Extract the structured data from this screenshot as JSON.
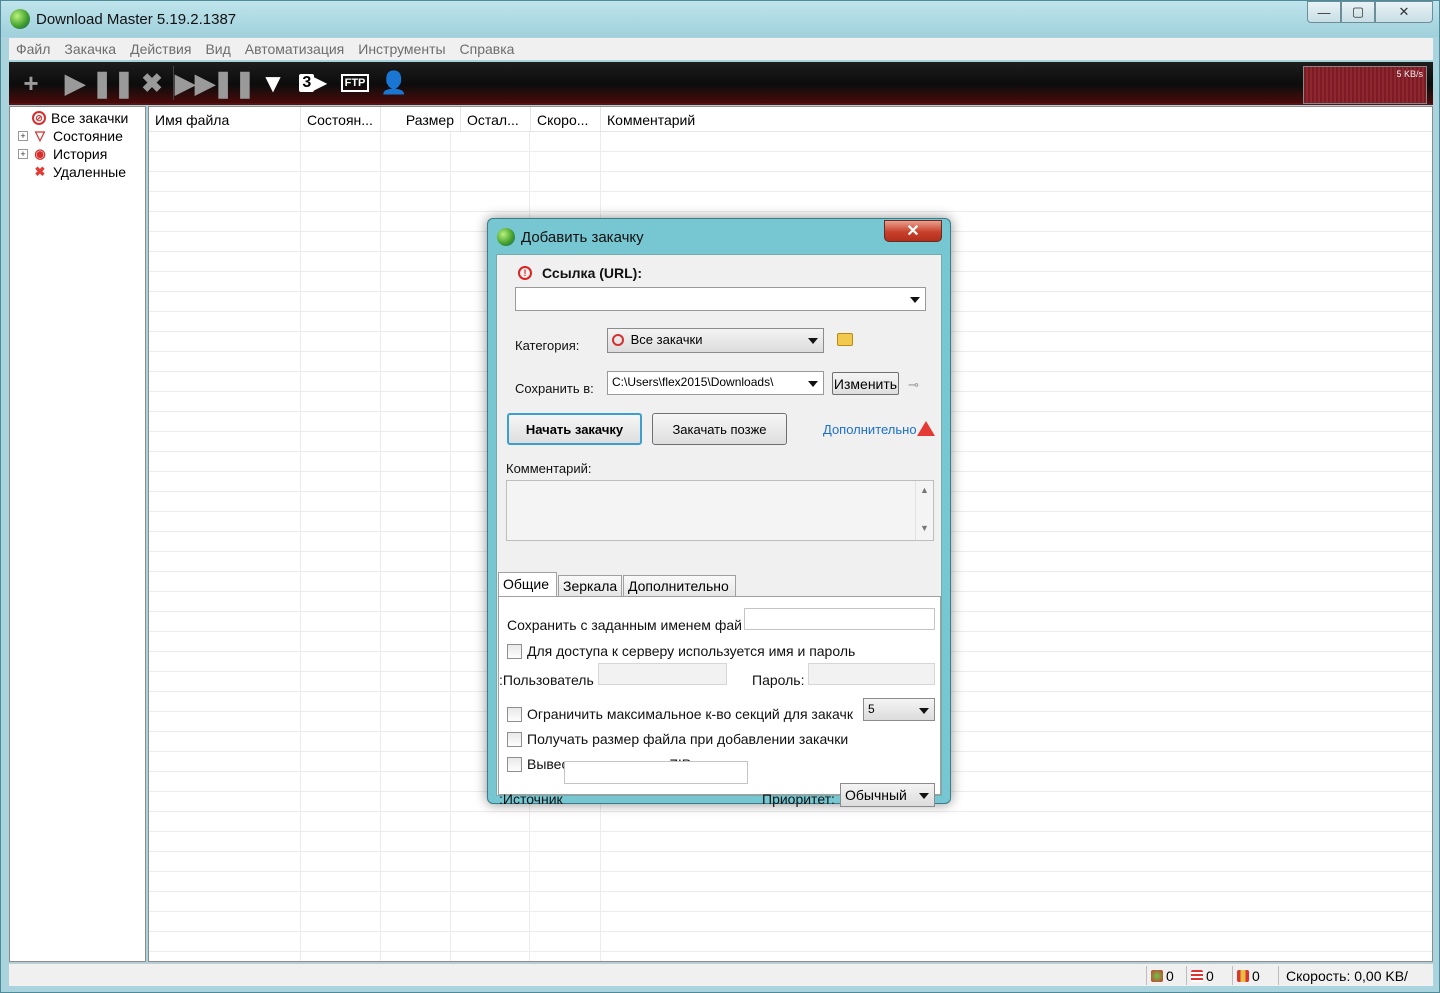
{
  "window": {
    "title": "Download Master 5.19.2.1387",
    "caption_min": "—",
    "caption_max": "▢",
    "caption_close": "✕"
  },
  "menu": [
    "Файл",
    "Закачка",
    "Действия",
    "Вид",
    "Автоматизация",
    "Инструменты",
    "Справка"
  ],
  "toolbar": {
    "buttons": [
      "add-icon",
      "play-icon",
      "pause-icon",
      "stop-icon",
      "play-all-icon",
      "pause-all-icon",
      "scheduler-icon",
      "turbo-icon",
      "ftp-icon",
      "user-icon"
    ],
    "ftp_label": "FTP",
    "turbo_label": "3",
    "speed_graph_label": "5 KB/s"
  },
  "tree": {
    "items": [
      {
        "label": "Все закачки",
        "icon": "all-downloads-icon",
        "color": "#d62f2f"
      },
      {
        "label": "Состояние",
        "icon": "status-filter-icon",
        "color": "#d62f2f"
      },
      {
        "label": "История",
        "icon": "history-icon",
        "color": "#d62f2f"
      },
      {
        "label": "Удаленные",
        "icon": "deleted-icon",
        "color": "#e53935"
      }
    ]
  },
  "list": {
    "columns": [
      "Имя файла",
      "Состоян...",
      "Размер",
      "Остал...",
      "Скоро...",
      "Комментарий"
    ],
    "rows": []
  },
  "status": {
    "active_count": "0",
    "queued_count": "0",
    "done_count": "0",
    "speed": "Скорость: 0,00 KB/"
  },
  "dialog": {
    "title": "Добавить закачку",
    "close_glyph": "✕",
    "url_label": "Ссылка (URL):",
    "url_value": "",
    "category_label": "Категория:",
    "category_value": "Все закачки",
    "save_to_label": "Сохранить в:",
    "save_to_value": "C:\\Users\\flex2015\\Downloads\\",
    "change_button": "Изменить",
    "start_button": "Начать закачку",
    "later_button": "Закачать позже",
    "advanced_link": "Дополнительно",
    "comment_label": "Комментарий:",
    "comment_value": "",
    "tabs": [
      "Общие",
      "Зеркала",
      "Дополнительно"
    ],
    "active_tab": "Общие",
    "general": {
      "save_as_label": "Сохранить с заданным именем фай",
      "save_as_value": "",
      "auth_checkbox": "Для доступа к серверу используется имя и пароль",
      "user_label": "Пользователь:",
      "password_label": "Пароль:",
      "limit_sections_checkbox": "Ограничить максимальное к-во секций для закачк",
      "sections_value": "5",
      "get_size_checkbox": "Получать размер файла при добавлении закачки",
      "zip_checkbox": "Вывести содержание ZIP архива",
      "source_label": "Источник:",
      "source_value": "",
      "priority_label": "Приоритет:",
      "priority_value": "Обычный"
    }
  }
}
